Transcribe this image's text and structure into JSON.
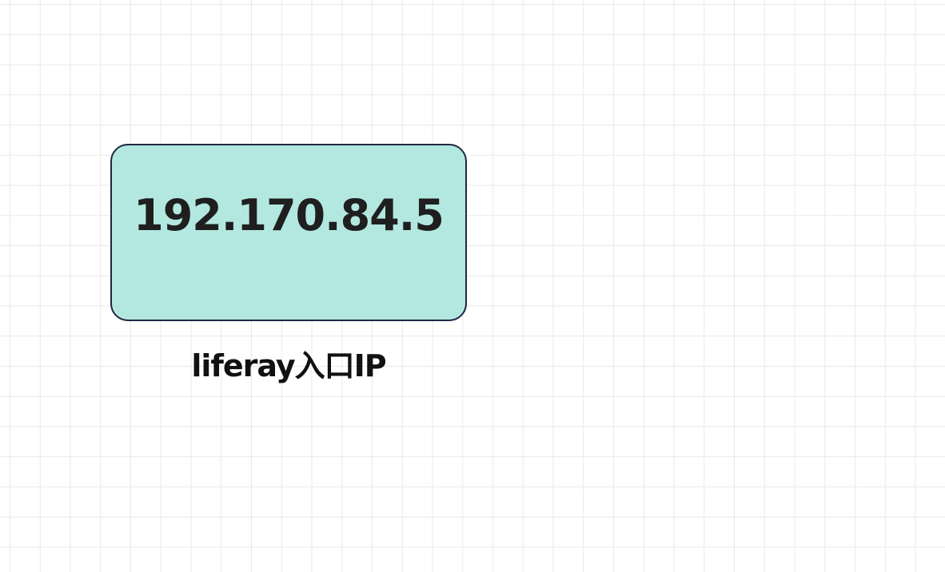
{
  "diagram": {
    "node": {
      "ip": "192.170.84.5",
      "caption": "liferay入口IP",
      "fill": "#b3e8e0",
      "border": "#1e2744"
    },
    "grid_color": "#e9e9e9"
  }
}
